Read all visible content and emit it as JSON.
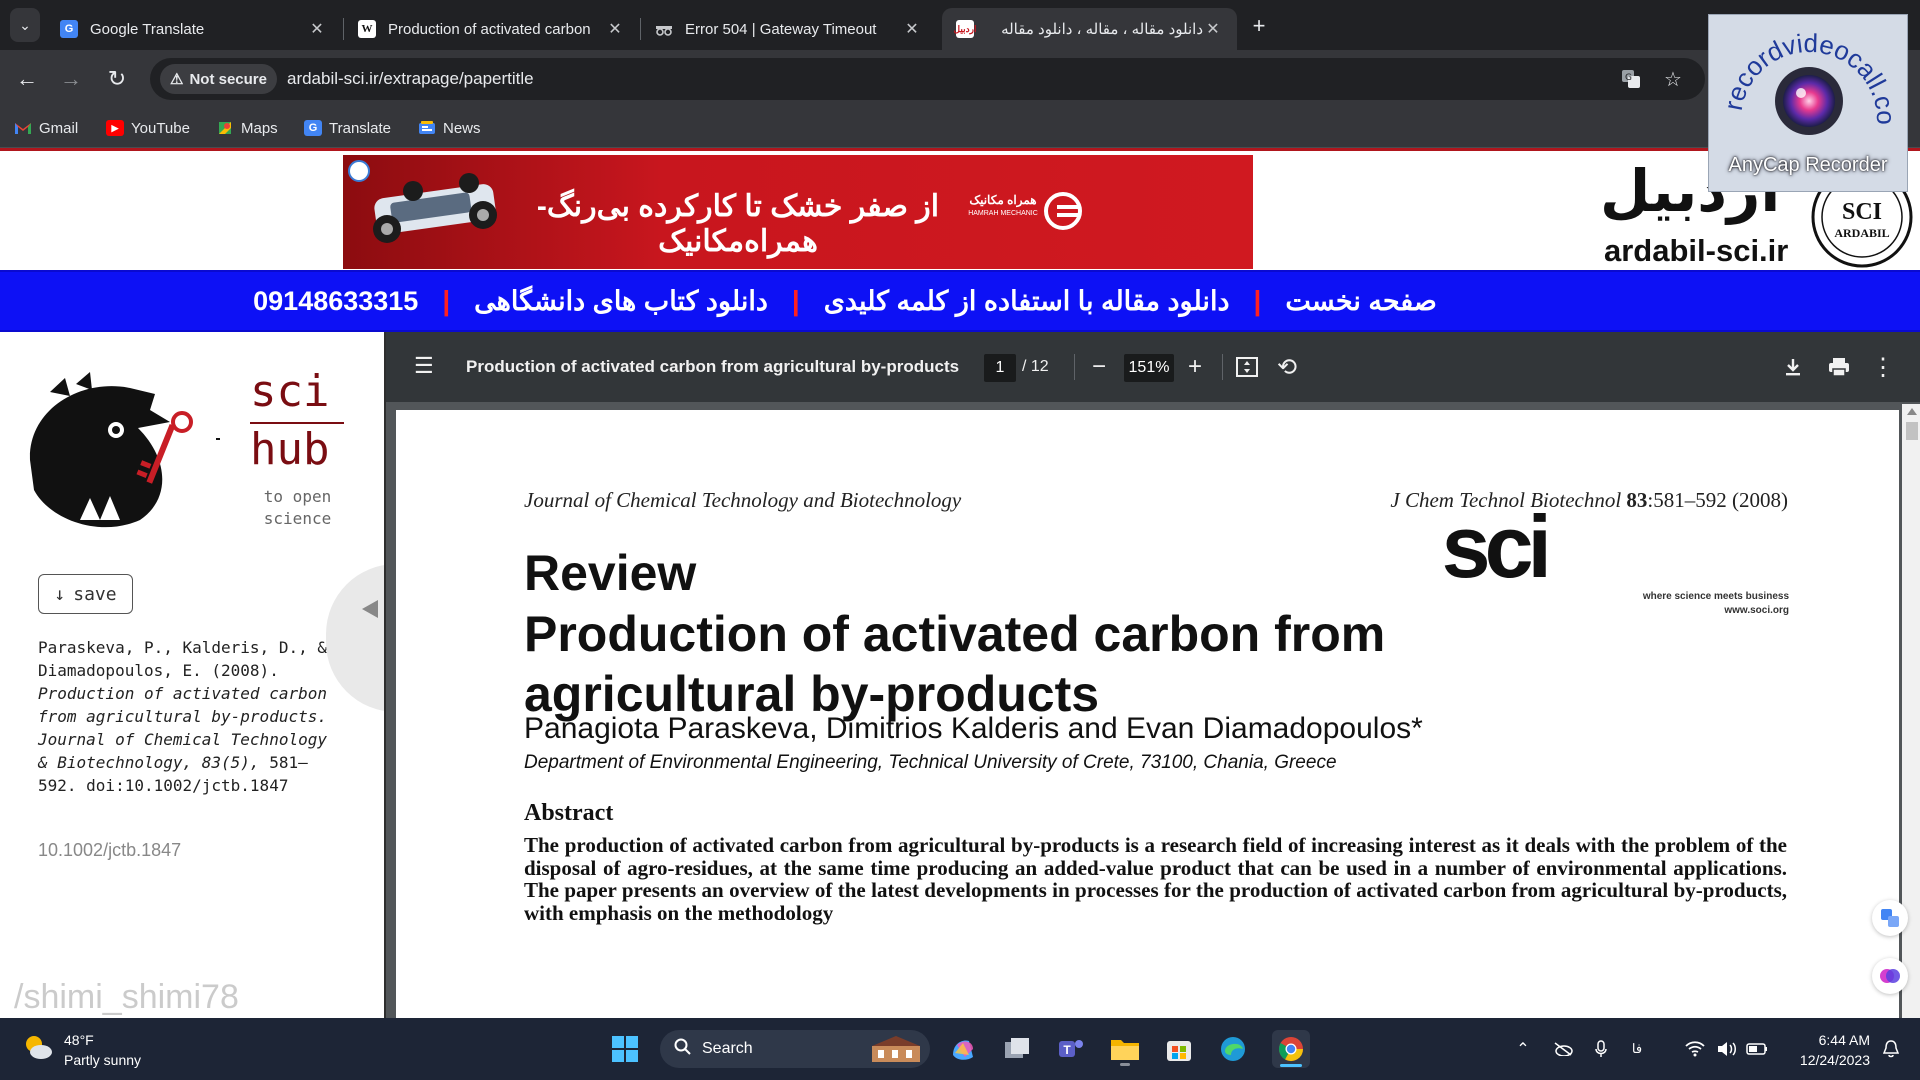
{
  "browser": {
    "tabs": [
      {
        "title": "Google Translate",
        "favicon": "google-translate-icon",
        "active": false
      },
      {
        "title": "Production of activated carbon",
        "favicon": "wikipedia-icon",
        "active": false
      },
      {
        "title": "Error 504 | Gateway Timeout",
        "favicon": "incognito-icon",
        "active": false
      },
      {
        "title": "دانلود مقاله ، مقاله ، دانلود مقاله",
        "favicon": "ardabil-sci-icon",
        "active": true
      }
    ],
    "close_glyph": "✕",
    "new_tab_glyph": "+",
    "security_label": "Not secure",
    "url": "ardabil-sci.ir/extrapage/papertitle",
    "bookmarks": [
      {
        "label": "Gmail",
        "icon": "gmail-icon"
      },
      {
        "label": "YouTube",
        "icon": "youtube-icon"
      },
      {
        "label": "Maps",
        "icon": "maps-icon"
      },
      {
        "label": "Translate",
        "icon": "translate-icon"
      },
      {
        "label": "News",
        "icon": "news-icon"
      }
    ]
  },
  "recorder": {
    "label": "AnyCap Recorder",
    "url_text": "recordvideocall.com"
  },
  "site": {
    "ad_text": "از صفر خشک تا کارکرده بی‌رنگ-همراه‌مکانیک",
    "ad_brand": "همراه مکانیک",
    "ad_brand_sub": "HAMRAH MECHANIC",
    "logo_text": "اردبیل",
    "domain": "ardabil-sci.ir",
    "emblem_text": "SCI",
    "emblem_sub": "ARDABIL",
    "nav": [
      {
        "label": "صفحه نخست"
      },
      {
        "label": "دانلود مقاله با استفاده از کلمه کلیدی"
      },
      {
        "label": "دانلود کتاب های دانشگاهی"
      },
      {
        "label": "09148633315"
      }
    ],
    "nav_separator": "|"
  },
  "scihub": {
    "word1": "sci",
    "word2": "hub",
    "tagline": "to open science",
    "save_label": "save",
    "save_icon": "download-arrow-icon",
    "citation_authors": "Paraskeva, P., Kalderis, D., & Diamadopoulos, E. (2008).",
    "citation_title": "Production of activated carbon from agricultural by-products. Journal of Chemical Technology & Biotechnology, 83(5),",
    "citation_tail": "581–592. doi:10.1002/jctb.1847",
    "doi": "10.1002/jctb.1847"
  },
  "pdf": {
    "title": "Production of activated carbon from agricultural by-products",
    "current_page": "1",
    "total_pages": "/ 12",
    "zoom": "151%",
    "page": {
      "journal_left": "Journal of Chemical Technology and Biotechnology",
      "journal_right_name": "J Chem Technol Biotechnol",
      "journal_right_volume": "83",
      "journal_right_pages": ":581–592 (2008)",
      "sci_logo": "sci",
      "sci_tagline": "where science meets business",
      "sci_url": "www.soci.org",
      "article_type": "Review",
      "title": "Production of activated carbon from agricultural by-products",
      "authors": "Panagiota Paraskeva, Dimitrios Kalderis and Evan Diamadopoulos*",
      "affiliation": "Department of Environmental Engineering, Technical University of Crete, 73100, Chania, Greece",
      "abstract_heading": "Abstract",
      "abstract_text": "The production of activated carbon from agricultural by-products is a research field of increasing interest as it deals with the problem of the disposal of agro-residues, at the same time producing an added-value product that can be used in a number of environmental applications. The paper presents an overview of the latest developments in processes for the production of activated carbon from agricultural by-products, with emphasis on the methodology"
    }
  },
  "watermark": "/shimi_shimi78",
  "taskbar": {
    "temperature": "48°F",
    "weather": "Partly sunny",
    "search_label": "Search",
    "lang": "فا",
    "time": "6:44 AM",
    "date": "12/24/2023"
  },
  "colors": {
    "nav_blue": "#0d11f5",
    "ad_red": "#c8161e",
    "scihub_red": "#7a0d12",
    "chrome_dark": "#202124",
    "taskbar": "#1d2536"
  }
}
